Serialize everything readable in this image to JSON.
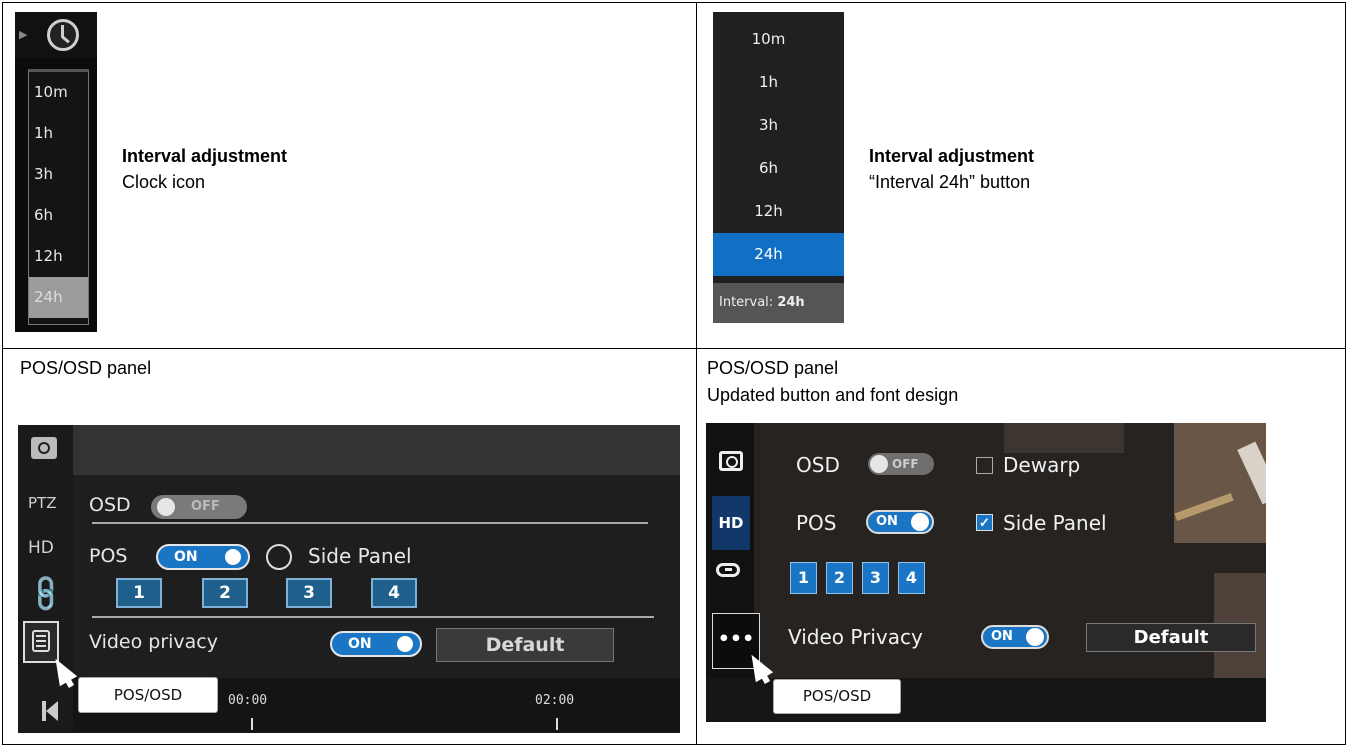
{
  "cell1": {
    "menu_items": [
      "10m",
      "1h",
      "3h",
      "6h",
      "12h",
      "24h"
    ],
    "selected": "24h",
    "title": "Interval adjustment",
    "subtitle": "Clock icon"
  },
  "cell2": {
    "menu_items": [
      "10m",
      "1h",
      "3h",
      "6h",
      "12h",
      "24h"
    ],
    "selected": "24h",
    "footer_label": "Interval:",
    "footer_value": "24h",
    "title": "Interval adjustment",
    "subtitle": "“Interval 24h” button"
  },
  "cell3": {
    "caption": "POS/OSD panel",
    "sidebar": {
      "ptz": "PTZ",
      "hd": "HD"
    },
    "osd_label": "OSD",
    "osd_toggle": "OFF",
    "pos_label": "POS",
    "pos_toggle": "ON",
    "side_panel_label": "Side Panel",
    "numbers": [
      "1",
      "2",
      "3",
      "4"
    ],
    "video_privacy_label": "Video privacy",
    "video_privacy_toggle": "ON",
    "default_button": "Default",
    "tooltip": "POS/OSD",
    "timeline": {
      "t1": "00:00",
      "t2": "02:00"
    }
  },
  "cell4": {
    "caption": "POS/OSD panel",
    "caption2": "Updated button and font design",
    "sidebar": {
      "hd": "HD",
      "more": "•••"
    },
    "osd_label": "OSD",
    "osd_toggle": "OFF",
    "dewarp_label": "Dewarp",
    "pos_label": "POS",
    "pos_toggle": "ON",
    "side_panel_label": "Side Panel",
    "numbers": [
      "1",
      "2",
      "3",
      "4"
    ],
    "video_privacy_label": "Video Privacy",
    "video_privacy_toggle": "ON",
    "default_button": "Default",
    "tooltip": "POS/OSD"
  },
  "colors": {
    "accent_blue": "#1170c4",
    "dark_bg": "#1e1e1e",
    "selected_gray": "#9b9b9b"
  },
  "icons": [
    "clock-icon",
    "camera-icon",
    "link-icon",
    "osd-panel-icon",
    "cursor-icon",
    "skip-back-icon",
    "more-icon"
  ]
}
